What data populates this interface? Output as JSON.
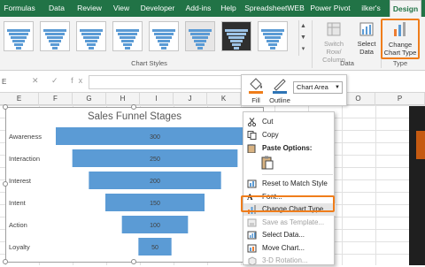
{
  "ribbon": {
    "tabs": [
      "Formulas",
      "Data",
      "Review",
      "View",
      "Developer",
      "Add-ins",
      "Help",
      "SpreadsheetWEB",
      "Power Pivot",
      "ilker's",
      "Design"
    ],
    "active_tab": "Design",
    "groups": {
      "chart_styles": "Chart Styles",
      "data": "Data",
      "type": "Type"
    },
    "buttons": {
      "switch_row_col": [
        "Switch Row/",
        "Column"
      ],
      "select_data": [
        "Select",
        "Data"
      ],
      "change_chart_type": [
        "Change",
        "Chart Type"
      ]
    }
  },
  "formula_bar": {
    "name_box": "E",
    "fx_icons": "✕ ✓ fx"
  },
  "columns": [
    "E",
    "F",
    "G",
    "H",
    "I",
    "J",
    "K",
    "L",
    "M",
    "N",
    "O",
    "P"
  ],
  "chart": {
    "title": "Sales Funnel Stages",
    "bar_color": "#5b9bd5"
  },
  "chart_data": {
    "type": "bar",
    "subtype": "funnel",
    "title": "Sales Funnel Stages",
    "categories": [
      "Awareness",
      "Interaction",
      "Interest",
      "Intent",
      "Action",
      "Loyalty"
    ],
    "values": [
      300,
      250,
      200,
      150,
      100,
      50
    ],
    "xlabel": "",
    "ylabel": "",
    "legend": "none",
    "grid": false
  },
  "mini_toolbar": {
    "fill": "Fill",
    "outline": "Outline",
    "dropdown": "Chart Area"
  },
  "context_menu": {
    "items": [
      {
        "label": "Cut",
        "icon": "scissors-icon",
        "disabled": false
      },
      {
        "label": "Copy",
        "icon": "copy-icon",
        "disabled": false
      },
      {
        "label": "Paste Options:",
        "icon": "paste-icon",
        "disabled": false,
        "bold": true
      },
      {
        "label": "",
        "icon": "paste-option-icon",
        "disabled": false
      },
      {
        "label": "Reset to Match Style",
        "icon": "reset-style-icon",
        "disabled": false
      },
      {
        "label": "Font...",
        "icon": "font-icon",
        "disabled": false
      },
      {
        "label": "Change Chart Type...",
        "icon": "chart-type-icon",
        "disabled": false,
        "highlighted": true
      },
      {
        "label": "Save as Template...",
        "icon": "save-template-icon",
        "disabled": true
      },
      {
        "label": "Select Data...",
        "icon": "select-data-icon",
        "disabled": false
      },
      {
        "label": "Move Chart...",
        "icon": "move-chart-icon",
        "disabled": false
      },
      {
        "label": "3-D Rotation...",
        "icon": "rotation-icon",
        "disabled": true
      }
    ]
  },
  "colors": {
    "excel_green": "#217346",
    "highlight_orange": "#ef7d1b",
    "funnel_blue": "#5b9bd5"
  }
}
